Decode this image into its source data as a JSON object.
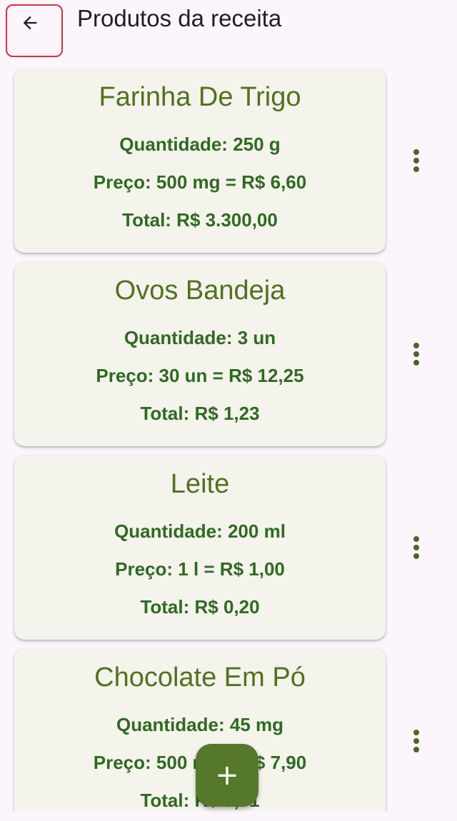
{
  "header": {
    "title": "Produtos da receita",
    "back_icon": "arrow-back-icon"
  },
  "products": [
    {
      "name": "Farinha De Trigo",
      "quantity": "Quantidade: 250 g",
      "price": "Preço: 500 mg = R$ 6,60",
      "total": "Total: R$ 3.300,00"
    },
    {
      "name": "Ovos Bandeja",
      "quantity": "Quantidade: 3 un",
      "price": "Preço: 30 un = R$ 12,25",
      "total": "Total: R$ 1,23"
    },
    {
      "name": "Leite",
      "quantity": "Quantidade: 200 ml",
      "price": "Preço: 1 l = R$ 1,00",
      "total": "Total: R$ 0,20"
    },
    {
      "name": "Chocolate Em Pó",
      "quantity": "Quantidade: 45 mg",
      "price": "Preço: 500 mg = R$ 7,90",
      "total": "Total: R$ 0,71"
    }
  ],
  "fab": {
    "label": "+",
    "icon": "add-icon"
  },
  "colors": {
    "background": "#fcf5fb",
    "card": "#f4f3ec",
    "title_green": "#52711f",
    "text_green": "#2f6a21",
    "fab": "#55782a",
    "highlight_border": "#d8303a"
  }
}
